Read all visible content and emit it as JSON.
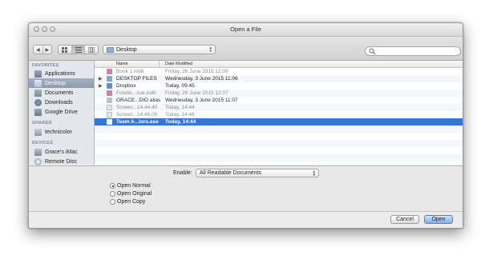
{
  "window": {
    "title": "Open a File"
  },
  "toolbar": {
    "location": "Desktop"
  },
  "sidebar": {
    "sections": [
      {
        "heading": "FAVORITES",
        "items": [
          {
            "label": "Applications",
            "icon": "applications-icon"
          },
          {
            "label": "Desktop",
            "icon": "desktop-icon",
            "selected": true
          },
          {
            "label": "Documents",
            "icon": "documents-icon"
          },
          {
            "label": "Downloads",
            "icon": "downloads-icon"
          },
          {
            "label": "Google Drive",
            "icon": "google-drive-icon"
          }
        ]
      },
      {
        "heading": "SHARED",
        "items": [
          {
            "label": "technicolor",
            "icon": "server-icon"
          }
        ]
      },
      {
        "heading": "DEVICES",
        "items": [
          {
            "label": "Grace's iMac",
            "icon": "imac-icon"
          },
          {
            "label": "Remote Disc",
            "icon": "disc-icon"
          }
        ]
      }
    ]
  },
  "file_list": {
    "columns": [
      "Name",
      "Date Modified"
    ],
    "rows": [
      {
        "name": "Book 1.indb",
        "date": "Friday, 26 June 2015 12:09",
        "dim": true,
        "icon": "indesign-book-icon"
      },
      {
        "name": "DESKTOP FILES",
        "date": "Wednesday, 3 June 2015 11:06",
        "folder": true,
        "icon": "folder-icon"
      },
      {
        "name": "Dropbox",
        "date": "Today, 09:45",
        "folder": true,
        "icon": "dropbox-folder-icon"
      },
      {
        "name": "Foodie...sue.indb",
        "date": "Friday, 26 June 2015 12:07",
        "dim": true,
        "icon": "indesign-book-icon"
      },
      {
        "name": "GRACE...DIO alias",
        "date": "Wednesday, 3 June 2015 11:07",
        "icon": "alias-icon"
      },
      {
        "name": "Screen...14.44.40",
        "date": "Today, 14:44",
        "dim": true,
        "icon": "screenshot-icon"
      },
      {
        "name": "Screen...14.46.00",
        "date": "Today, 14:46",
        "dim": true,
        "icon": "screenshot-icon"
      },
      {
        "name": "Team A...lors.ase",
        "date": "Today, 14:44",
        "selected": true,
        "icon": "ase-file-icon"
      }
    ]
  },
  "options": {
    "enable_label": "Enable:",
    "enable_value": "All Readable Documents",
    "radios": [
      {
        "label": "Open Normal",
        "checked": true
      },
      {
        "label": "Open Original",
        "checked": false
      },
      {
        "label": "Open Copy",
        "checked": false
      }
    ]
  },
  "buttons": {
    "cancel": "Cancel",
    "open": "Open"
  }
}
